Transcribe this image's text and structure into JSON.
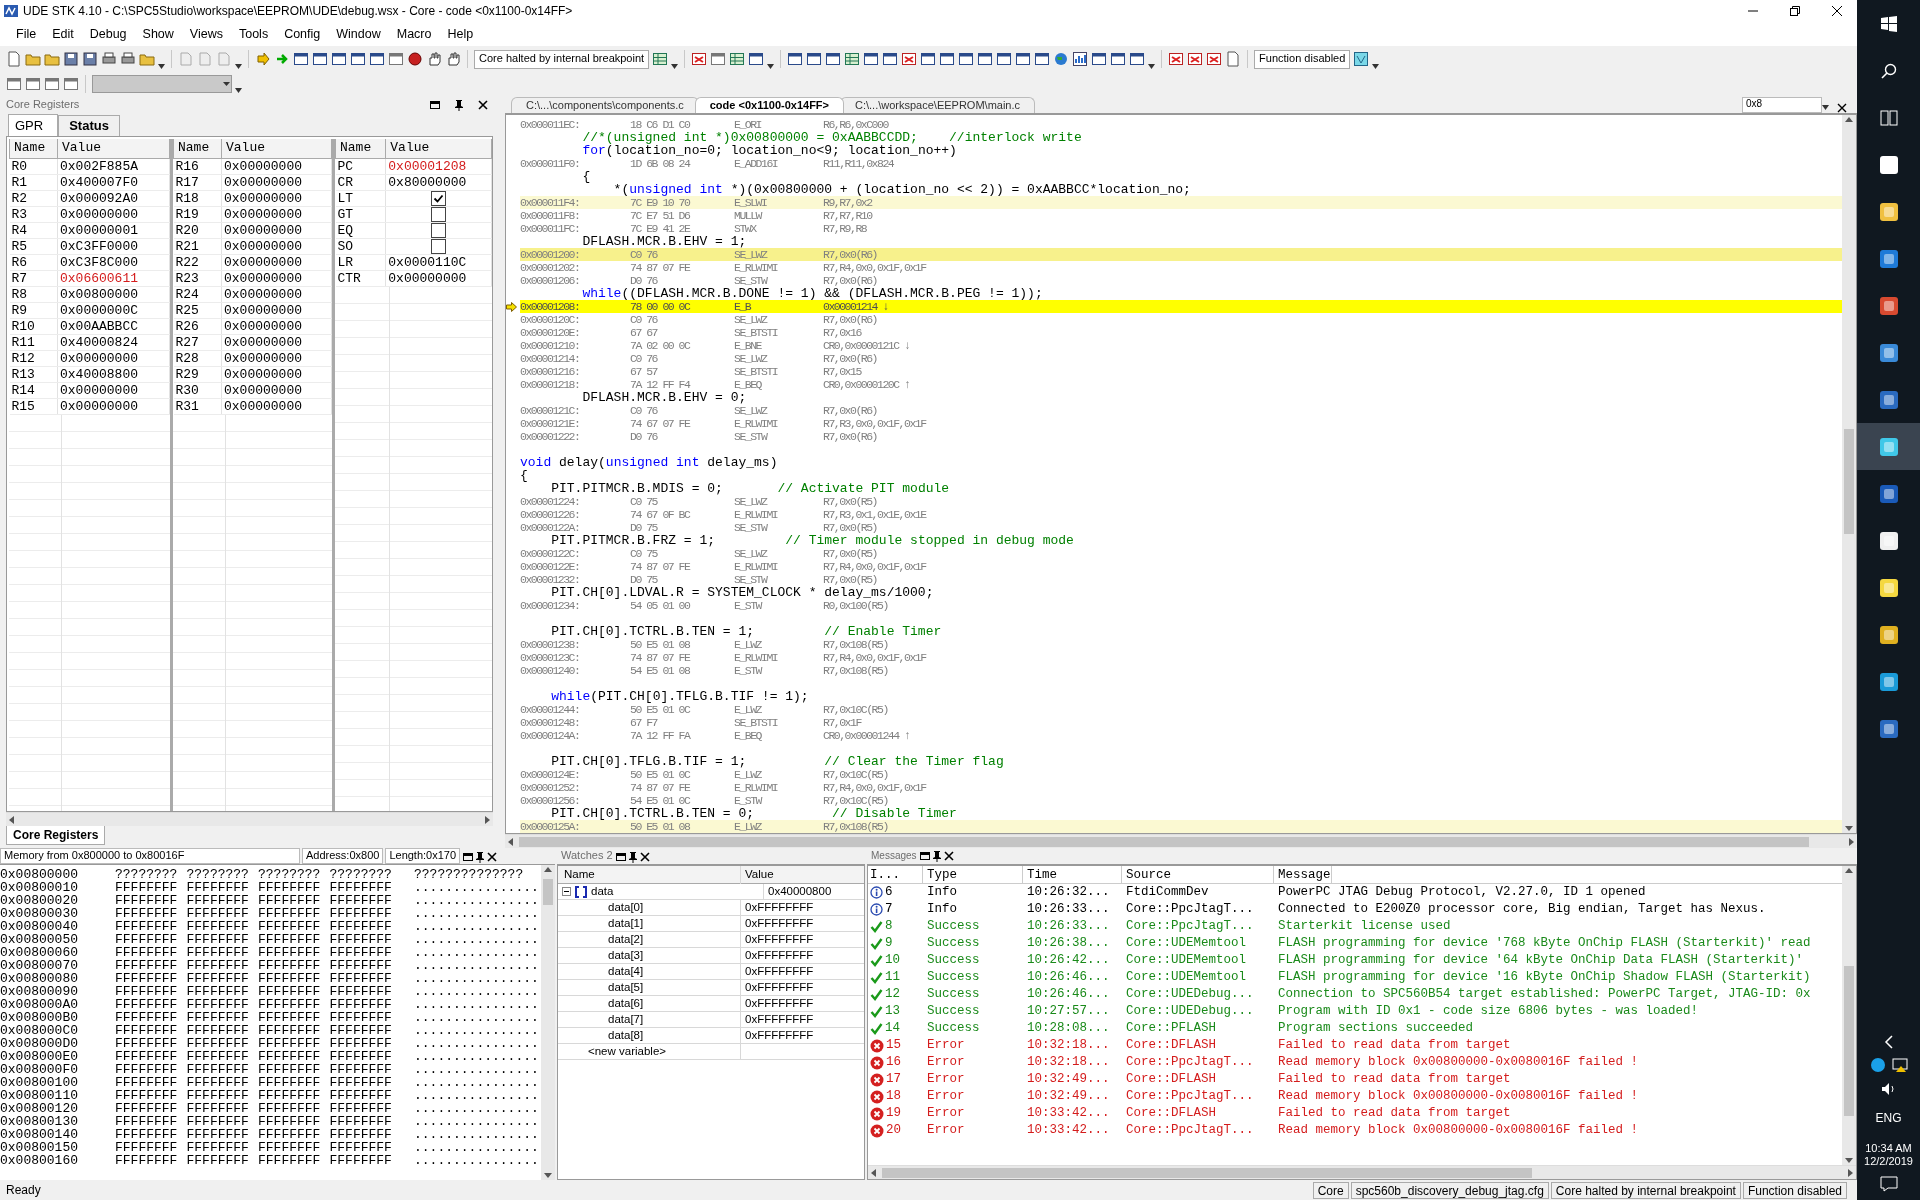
{
  "window": {
    "title": "UDE STK 4.10 - C:\\SPC5Studio\\workspace\\EEPROM\\UDE\\debug.wsx - Core - code <0x1100-0x14FF>"
  },
  "menu": [
    "File",
    "Edit",
    "Debug",
    "Show",
    "Views",
    "Tools",
    "Config",
    "Window",
    "Macro",
    "Help"
  ],
  "toolbar": {
    "status_field": "Core halted by internal breakpoint",
    "function_field": "Function disabled",
    "combo": {
      "disabled": true
    }
  },
  "registers": {
    "title": "Core Registers",
    "tabs": [
      {
        "label": "GPR",
        "selected": true
      },
      {
        "label": "Status",
        "selected": false
      }
    ],
    "groups": [
      {
        "columns": [
          "Name",
          "Value"
        ],
        "rows": [
          {
            "kind": "value",
            "name": "R0",
            "value": "0x002F885A",
            "changed": false
          },
          {
            "kind": "value",
            "name": "R1",
            "value": "0x400007F0",
            "changed": false
          },
          {
            "kind": "value",
            "name": "R2",
            "value": "0x000092A0",
            "changed": false
          },
          {
            "kind": "value",
            "name": "R3",
            "value": "0x00000000",
            "changed": false
          },
          {
            "kind": "value",
            "name": "R4",
            "value": "0x00000001",
            "changed": false
          },
          {
            "kind": "value",
            "name": "R5",
            "value": "0xC3FF0000",
            "changed": false
          },
          {
            "kind": "value",
            "name": "R6",
            "value": "0xC3F8C000",
            "changed": false
          },
          {
            "kind": "value",
            "name": "R7",
            "value": "0x06600611",
            "changed": true
          },
          {
            "kind": "value",
            "name": "R8",
            "value": "0x00800000",
            "changed": false
          },
          {
            "kind": "value",
            "name": "R9",
            "value": "0x0000000C",
            "changed": false
          },
          {
            "kind": "value",
            "name": "R10",
            "value": "0x00AABBCC",
            "changed": false
          },
          {
            "kind": "value",
            "name": "R11",
            "value": "0x40000824",
            "changed": false
          },
          {
            "kind": "value",
            "name": "R12",
            "value": "0x00000000",
            "changed": false
          },
          {
            "kind": "value",
            "name": "R13",
            "value": "0x40008800",
            "changed": false
          },
          {
            "kind": "value",
            "name": "R14",
            "value": "0x00000000",
            "changed": false
          },
          {
            "kind": "value",
            "name": "R15",
            "value": "0x00000000",
            "changed": false
          }
        ]
      },
      {
        "columns": [
          "Name",
          "Value"
        ],
        "rows": [
          {
            "kind": "value",
            "name": "R16",
            "value": "0x00000000",
            "changed": false
          },
          {
            "kind": "value",
            "name": "R17",
            "value": "0x00000000",
            "changed": false
          },
          {
            "kind": "value",
            "name": "R18",
            "value": "0x00000000",
            "changed": false
          },
          {
            "kind": "value",
            "name": "R19",
            "value": "0x00000000",
            "changed": false
          },
          {
            "kind": "value",
            "name": "R20",
            "value": "0x00000000",
            "changed": false
          },
          {
            "kind": "value",
            "name": "R21",
            "value": "0x00000000",
            "changed": false
          },
          {
            "kind": "value",
            "name": "R22",
            "value": "0x00000000",
            "changed": false
          },
          {
            "kind": "value",
            "name": "R23",
            "value": "0x00000000",
            "changed": false
          },
          {
            "kind": "value",
            "name": "R24",
            "value": "0x00000000",
            "changed": false
          },
          {
            "kind": "value",
            "name": "R25",
            "value": "0x00000000",
            "changed": false
          },
          {
            "kind": "value",
            "name": "R26",
            "value": "0x00000000",
            "changed": false
          },
          {
            "kind": "value",
            "name": "R27",
            "value": "0x00000000",
            "changed": false
          },
          {
            "kind": "value",
            "name": "R28",
            "value": "0x00000000",
            "changed": false
          },
          {
            "kind": "value",
            "name": "R29",
            "value": "0x00000000",
            "changed": false
          },
          {
            "kind": "value",
            "name": "R30",
            "value": "0x00000000",
            "changed": false
          },
          {
            "kind": "value",
            "name": "R31",
            "value": "0x00000000",
            "changed": false
          }
        ]
      },
      {
        "columns": [
          "Name",
          "Value"
        ],
        "rows": [
          {
            "kind": "value",
            "name": "PC",
            "value": "0x00001208",
            "changed": true
          },
          {
            "kind": "value",
            "name": "CR",
            "value": "0x80000000",
            "changed": false
          },
          {
            "kind": "flag",
            "name": "LT",
            "checked": true
          },
          {
            "kind": "flag",
            "name": "GT",
            "checked": false
          },
          {
            "kind": "flag",
            "name": "EQ",
            "checked": false
          },
          {
            "kind": "flag",
            "name": "SO",
            "checked": false
          },
          {
            "kind": "value",
            "name": "LR",
            "value": "0x0000110C",
            "changed": false
          },
          {
            "kind": "value",
            "name": "CTR",
            "value": "0x00000000",
            "changed": false
          }
        ]
      }
    ],
    "bottom_tab": {
      "label": "Core Registers",
      "selected": true
    }
  },
  "code": {
    "tabs": [
      {
        "label": "C:\\...\\components\\components.c",
        "selected": false
      },
      {
        "label": "code <0x1100-0x14FF>",
        "selected": true
      },
      {
        "label": "C:\\...\\workspace\\EEPROM\\main.c",
        "selected": false
      }
    ],
    "address_field": "0x8",
    "lines": [
      {
        "kind": "asm",
        "address": "0x000011EC:",
        "bytes": "18 C6 D1 C0",
        "mnemonic": "E_ORI",
        "operands": "R6,R6,0xC000",
        "current": false,
        "highlighted": false,
        "emphasized": false
      },
      {
        "kind": "src",
        "segments": [
          {
            "text": "        //*(unsigned int *)0x00800000 = 0xAABBCCDD;    //interlock write",
            "kind": "comment"
          }
        ]
      },
      {
        "kind": "src",
        "segments": [
          {
            "text": "        for",
            "kind": "keyword"
          },
          {
            "text": "(location_no=0; location_no<9; location_no++)",
            "kind": "plain"
          }
        ]
      },
      {
        "kind": "asm",
        "address": "0x000011F0:",
        "bytes": "1D 6B 08 24",
        "mnemonic": "E_ADD16I",
        "operands": "R11,R11,0x824",
        "current": false,
        "highlighted": false,
        "emphasized": false
      },
      {
        "kind": "src",
        "segments": [
          {
            "text": "        {",
            "kind": "plain"
          }
        ]
      },
      {
        "kind": "src",
        "segments": [
          {
            "text": "            *(",
            "kind": "plain"
          },
          {
            "text": "unsigned int",
            "kind": "keyword"
          },
          {
            "text": " *)(0x00800000 + (location_no << 2)) = 0xAABBCC*location_no;",
            "kind": "plain"
          }
        ]
      },
      {
        "kind": "asm",
        "address": "0x000011F4:",
        "bytes": "7C E9 10 70",
        "mnemonic": "E_SLWI",
        "operands": "R9,R7,0x2",
        "current": false,
        "highlighted": true,
        "emphasized": false
      },
      {
        "kind": "asm",
        "address": "0x000011F8:",
        "bytes": "7C E7 51 D6",
        "mnemonic": "MULLW",
        "operands": "R7,R7,R10",
        "current": false,
        "highlighted": false,
        "emphasized": false
      },
      {
        "kind": "asm",
        "address": "0x000011FC:",
        "bytes": "7C E9 41 2E",
        "mnemonic": "STWX",
        "operands": "R7,R9,R8",
        "current": false,
        "highlighted": false,
        "emphasized": false
      },
      {
        "kind": "src",
        "segments": [
          {
            "text": "        DFLASH.MCR.B.EHV = 1;",
            "kind": "plain"
          }
        ]
      },
      {
        "kind": "asm",
        "address": "0x00001200:",
        "bytes": "C0 76",
        "mnemonic": "SE_LWZ",
        "operands": "R7,0x0(R6)",
        "current": false,
        "highlighted": false,
        "emphasized": true
      },
      {
        "kind": "asm",
        "address": "0x00001202:",
        "bytes": "74 87 07 FE",
        "mnemonic": "E_RLWIMI",
        "operands": "R7,R4,0x0,0x1F,0x1F",
        "current": false,
        "highlighted": false,
        "emphasized": false
      },
      {
        "kind": "asm",
        "address": "0x00001206:",
        "bytes": "D0 76",
        "mnemonic": "SE_STW",
        "operands": "R7,0x0(R6)",
        "current": false,
        "highlighted": false,
        "emphasized": false
      },
      {
        "kind": "src",
        "segments": [
          {
            "text": "        while",
            "kind": "keyword"
          },
          {
            "text": "((DFLASH.MCR.B.DONE != 1) && (DFLASH.MCR.B.PEG != 1));",
            "kind": "plain"
          }
        ]
      },
      {
        "kind": "asm",
        "address": "0x00001208:",
        "bytes": "78 00 00 0C",
        "mnemonic": "E_B",
        "operands": "0x00001214 ↓",
        "current": true,
        "highlighted": false,
        "emphasized": false
      },
      {
        "kind": "asm",
        "address": "0x0000120C:",
        "bytes": "C0 76",
        "mnemonic": "SE_LWZ",
        "operands": "R7,0x0(R6)",
        "current": false,
        "highlighted": false,
        "emphasized": false
      },
      {
        "kind": "asm",
        "address": "0x0000120E:",
        "bytes": "67 67",
        "mnemonic": "SE_BTSTI",
        "operands": "R7,0x16",
        "current": false,
        "highlighted": false,
        "emphasized": false
      },
      {
        "kind": "asm",
        "address": "0x00001210:",
        "bytes": "7A 02 00 0C",
        "mnemonic": "E_BNE",
        "operands": "CR0,0x0000121C ↓",
        "current": false,
        "highlighted": false,
        "emphasized": false
      },
      {
        "kind": "asm",
        "address": "0x00001214:",
        "bytes": "C0 76",
        "mnemonic": "SE_LWZ",
        "operands": "R7,0x0(R6)",
        "current": false,
        "highlighted": false,
        "emphasized": false
      },
      {
        "kind": "asm",
        "address": "0x00001216:",
        "bytes": "67 57",
        "mnemonic": "SE_BTSTI",
        "operands": "R7,0x15",
        "current": false,
        "highlighted": false,
        "emphasized": false
      },
      {
        "kind": "asm",
        "address": "0x00001218:",
        "bytes": "7A 12 FF F4",
        "mnemonic": "E_BEQ",
        "operands": "CR0,0x0000120C ↑",
        "current": false,
        "highlighted": false,
        "emphasized": false
      },
      {
        "kind": "src",
        "segments": [
          {
            "text": "        DFLASH.MCR.B.EHV = 0;",
            "kind": "plain"
          }
        ]
      },
      {
        "kind": "asm",
        "address": "0x0000121C:",
        "bytes": "C0 76",
        "mnemonic": "SE_LWZ",
        "operands": "R7,0x0(R6)",
        "current": false,
        "highlighted": false,
        "emphasized": false
      },
      {
        "kind": "asm",
        "address": "0x0000121E:",
        "bytes": "74 67 07 FE",
        "mnemonic": "E_RLWIMI",
        "operands": "R7,R3,0x0,0x1F,0x1F",
        "current": false,
        "highlighted": false,
        "emphasized": false
      },
      {
        "kind": "asm",
        "address": "0x00001222:",
        "bytes": "D0 76",
        "mnemonic": "SE_STW",
        "operands": "R7,0x0(R6)",
        "current": false,
        "highlighted": false,
        "emphasized": false
      },
      {
        "kind": "blank"
      },
      {
        "kind": "src",
        "segments": [
          {
            "text": "void",
            "kind": "keyword"
          },
          {
            "text": " delay(",
            "kind": "plain"
          },
          {
            "text": "unsigned int",
            "kind": "keyword"
          },
          {
            "text": " delay_ms)",
            "kind": "plain"
          }
        ]
      },
      {
        "kind": "src",
        "segments": [
          {
            "text": "{",
            "kind": "plain"
          }
        ]
      },
      {
        "kind": "src",
        "segments": [
          {
            "text": "    PIT.PITMCR.B.MDIS = 0;",
            "kind": "plain"
          },
          {
            "text": "       // Activate PIT module",
            "kind": "comment"
          }
        ]
      },
      {
        "kind": "asm",
        "address": "0x00001224:",
        "bytes": "C0 75",
        "mnemonic": "SE_LWZ",
        "operands": "R7,0x0(R5)",
        "current": false,
        "highlighted": false,
        "emphasized": false
      },
      {
        "kind": "asm",
        "address": "0x00001226:",
        "bytes": "74 67 0F BC",
        "mnemonic": "E_RLWIMI",
        "operands": "R7,R3,0x1,0x1E,0x1E",
        "current": false,
        "highlighted": false,
        "emphasized": false
      },
      {
        "kind": "asm",
        "address": "0x0000122A:",
        "bytes": "D0 75",
        "mnemonic": "SE_STW",
        "operands": "R7,0x0(R5)",
        "current": false,
        "highlighted": false,
        "emphasized": false
      },
      {
        "kind": "src",
        "segments": [
          {
            "text": "    PIT.PITMCR.B.FRZ = 1;",
            "kind": "plain"
          },
          {
            "text": "         // Timer module stopped in debug mode",
            "kind": "comment"
          }
        ]
      },
      {
        "kind": "asm",
        "address": "0x0000122C:",
        "bytes": "C0 75",
        "mnemonic": "SE_LWZ",
        "operands": "R7,0x0(R5)",
        "current": false,
        "highlighted": false,
        "emphasized": false
      },
      {
        "kind": "asm",
        "address": "0x0000122E:",
        "bytes": "74 87 07 FE",
        "mnemonic": "E_RLWIMI",
        "operands": "R7,R4,0x0,0x1F,0x1F",
        "current": false,
        "highlighted": false,
        "emphasized": false
      },
      {
        "kind": "asm",
        "address": "0x00001232:",
        "bytes": "D0 75",
        "mnemonic": "SE_STW",
        "operands": "R7,0x0(R5)",
        "current": false,
        "highlighted": false,
        "emphasized": false
      },
      {
        "kind": "src",
        "segments": [
          {
            "text": "    PIT.CH[0].LDVAL.R = SYSTEM_CLOCK * delay_ms/1000;",
            "kind": "plain"
          }
        ]
      },
      {
        "kind": "asm",
        "address": "0x00001234:",
        "bytes": "54 05 01 00",
        "mnemonic": "E_STW",
        "operands": "R0,0x100(R5)",
        "current": false,
        "highlighted": false,
        "emphasized": false
      },
      {
        "kind": "blank"
      },
      {
        "kind": "src",
        "segments": [
          {
            "text": "    PIT.CH[0].TCTRL.B.TEN = 1;",
            "kind": "plain"
          },
          {
            "text": "         // Enable Timer",
            "kind": "comment"
          }
        ]
      },
      {
        "kind": "asm",
        "address": "0x00001238:",
        "bytes": "50 E5 01 08",
        "mnemonic": "E_LWZ",
        "operands": "R7,0x108(R5)",
        "current": false,
        "highlighted": false,
        "emphasized": false
      },
      {
        "kind": "asm",
        "address": "0x0000123C:",
        "bytes": "74 87 07 FE",
        "mnemonic": "E_RLWIMI",
        "operands": "R7,R4,0x0,0x1F,0x1F",
        "current": false,
        "highlighted": false,
        "emphasized": false
      },
      {
        "kind": "asm",
        "address": "0x00001240:",
        "bytes": "54 E5 01 08",
        "mnemonic": "E_STW",
        "operands": "R7,0x108(R5)",
        "current": false,
        "highlighted": false,
        "emphasized": false
      },
      {
        "kind": "blank"
      },
      {
        "kind": "src",
        "segments": [
          {
            "text": "    while",
            "kind": "keyword"
          },
          {
            "text": "(PIT.CH[0].TFLG.B.TIF != 1);",
            "kind": "plain"
          }
        ]
      },
      {
        "kind": "asm",
        "address": "0x00001244:",
        "bytes": "50 E5 01 0C",
        "mnemonic": "E_LWZ",
        "operands": "R7,0x10C(R5)",
        "current": false,
        "highlighted": false,
        "emphasized": false
      },
      {
        "kind": "asm",
        "address": "0x00001248:",
        "bytes": "67 F7",
        "mnemonic": "SE_BTSTI",
        "operands": "R7,0x1F",
        "current": false,
        "highlighted": false,
        "emphasized": false
      },
      {
        "kind": "asm",
        "address": "0x0000124A:",
        "bytes": "7A 12 FF FA",
        "mnemonic": "E_BEQ",
        "operands": "CR0,0x00001244 ↑",
        "current": false,
        "highlighted": false,
        "emphasized": false
      },
      {
        "kind": "blank"
      },
      {
        "kind": "src",
        "segments": [
          {
            "text": "    PIT.CH[0].TFLG.B.TIF = 1;",
            "kind": "plain"
          },
          {
            "text": "          // Clear the Timer flag",
            "kind": "comment"
          }
        ]
      },
      {
        "kind": "asm",
        "address": "0x0000124E:",
        "bytes": "50 E5 01 0C",
        "mnemonic": "E_LWZ",
        "operands": "R7,0x10C(R5)",
        "current": false,
        "highlighted": false,
        "emphasized": false
      },
      {
        "kind": "asm",
        "address": "0x00001252:",
        "bytes": "74 87 07 FE",
        "mnemonic": "E_RLWIMI",
        "operands": "R7,R4,0x0,0x1F,0x1F",
        "current": false,
        "highlighted": false,
        "emphasized": false
      },
      {
        "kind": "asm",
        "address": "0x00001256:",
        "bytes": "54 E5 01 0C",
        "mnemonic": "E_STW",
        "operands": "R7,0x10C(R5)",
        "current": false,
        "highlighted": false,
        "emphasized": false
      },
      {
        "kind": "src",
        "segments": [
          {
            "text": "    PIT.CH[0].TCTRL.B.TEN = 0;",
            "kind": "plain"
          },
          {
            "text": "          // Disable Timer",
            "kind": "comment"
          }
        ]
      },
      {
        "kind": "asm",
        "address": "0x0000125A:",
        "bytes": "50 E5 01 08",
        "mnemonic": "E_LWZ",
        "operands": "R7,0x108(R5)",
        "current": false,
        "highlighted": true,
        "emphasized": false
      }
    ]
  },
  "memory": {
    "title": "Memory from 0x800000 to 0x80016F",
    "address_field": "Address:0x800",
    "length_field": "Length:0x170",
    "rows": [
      {
        "address": "0x00800000",
        "words": [
          "????????",
          "????????",
          "????????",
          "????????"
        ],
        "ascii": "??????????????"
      },
      {
        "address": "0x00800010",
        "words": [
          "FFFFFFFF",
          "FFFFFFFF",
          "FFFFFFFF",
          "FFFFFFFF"
        ],
        "ascii": "................"
      },
      {
        "address": "0x00800020",
        "words": [
          "FFFFFFFF",
          "FFFFFFFF",
          "FFFFFFFF",
          "FFFFFFFF"
        ],
        "ascii": "................"
      },
      {
        "address": "0x00800030",
        "words": [
          "FFFFFFFF",
          "FFFFFFFF",
          "FFFFFFFF",
          "FFFFFFFF"
        ],
        "ascii": "................"
      },
      {
        "address": "0x00800040",
        "words": [
          "FFFFFFFF",
          "FFFFFFFF",
          "FFFFFFFF",
          "FFFFFFFF"
        ],
        "ascii": "................"
      },
      {
        "address": "0x00800050",
        "words": [
          "FFFFFFFF",
          "FFFFFFFF",
          "FFFFFFFF",
          "FFFFFFFF"
        ],
        "ascii": "................"
      },
      {
        "address": "0x00800060",
        "words": [
          "FFFFFFFF",
          "FFFFFFFF",
          "FFFFFFFF",
          "FFFFFFFF"
        ],
        "ascii": "................"
      },
      {
        "address": "0x00800070",
        "words": [
          "FFFFFFFF",
          "FFFFFFFF",
          "FFFFFFFF",
          "FFFFFFFF"
        ],
        "ascii": "................"
      },
      {
        "address": "0x00800080",
        "words": [
          "FFFFFFFF",
          "FFFFFFFF",
          "FFFFFFFF",
          "FFFFFFFF"
        ],
        "ascii": "................"
      },
      {
        "address": "0x00800090",
        "words": [
          "FFFFFFFF",
          "FFFFFFFF",
          "FFFFFFFF",
          "FFFFFFFF"
        ],
        "ascii": "................"
      },
      {
        "address": "0x008000A0",
        "words": [
          "FFFFFFFF",
          "FFFFFFFF",
          "FFFFFFFF",
          "FFFFFFFF"
        ],
        "ascii": "................"
      },
      {
        "address": "0x008000B0",
        "words": [
          "FFFFFFFF",
          "FFFFFFFF",
          "FFFFFFFF",
          "FFFFFFFF"
        ],
        "ascii": "................"
      },
      {
        "address": "0x008000C0",
        "words": [
          "FFFFFFFF",
          "FFFFFFFF",
          "FFFFFFFF",
          "FFFFFFFF"
        ],
        "ascii": "................"
      },
      {
        "address": "0x008000D0",
        "words": [
          "FFFFFFFF",
          "FFFFFFFF",
          "FFFFFFFF",
          "FFFFFFFF"
        ],
        "ascii": "................"
      },
      {
        "address": "0x008000E0",
        "words": [
          "FFFFFFFF",
          "FFFFFFFF",
          "FFFFFFFF",
          "FFFFFFFF"
        ],
        "ascii": "................"
      },
      {
        "address": "0x008000F0",
        "words": [
          "FFFFFFFF",
          "FFFFFFFF",
          "FFFFFFFF",
          "FFFFFFFF"
        ],
        "ascii": "................"
      },
      {
        "address": "0x00800100",
        "words": [
          "FFFFFFFF",
          "FFFFFFFF",
          "FFFFFFFF",
          "FFFFFFFF"
        ],
        "ascii": "................"
      },
      {
        "address": "0x00800110",
        "words": [
          "FFFFFFFF",
          "FFFFFFFF",
          "FFFFFFFF",
          "FFFFFFFF"
        ],
        "ascii": "................"
      },
      {
        "address": "0x00800120",
        "words": [
          "FFFFFFFF",
          "FFFFFFFF",
          "FFFFFFFF",
          "FFFFFFFF"
        ],
        "ascii": "................"
      },
      {
        "address": "0x00800130",
        "words": [
          "FFFFFFFF",
          "FFFFFFFF",
          "FFFFFFFF",
          "FFFFFFFF"
        ],
        "ascii": "................"
      },
      {
        "address": "0x00800140",
        "words": [
          "FFFFFFFF",
          "FFFFFFFF",
          "FFFFFFFF",
          "FFFFFFFF"
        ],
        "ascii": "................"
      },
      {
        "address": "0x00800150",
        "words": [
          "FFFFFFFF",
          "FFFFFFFF",
          "FFFFFFFF",
          "FFFFFFFF"
        ],
        "ascii": "................"
      },
      {
        "address": "0x00800160",
        "words": [
          "FFFFFFFF",
          "FFFFFFFF",
          "FFFFFFFF",
          "FFFFFFFF"
        ],
        "ascii": "................"
      }
    ]
  },
  "watches": {
    "title": "Watches 2",
    "columns": [
      "Name",
      "Value"
    ],
    "rows": [
      {
        "name": "data",
        "value": "0x40000800",
        "expanded": true,
        "children": [
          {
            "name": "data[0]",
            "value": "0xFFFFFFFF"
          },
          {
            "name": "data[1]",
            "value": "0xFFFFFFFF"
          },
          {
            "name": "data[2]",
            "value": "0xFFFFFFFF"
          },
          {
            "name": "data[3]",
            "value": "0xFFFFFFFF"
          },
          {
            "name": "data[4]",
            "value": "0xFFFFFFFF"
          },
          {
            "name": "data[5]",
            "value": "0xFFFFFFFF"
          },
          {
            "name": "data[6]",
            "value": "0xFFFFFFFF"
          },
          {
            "name": "data[7]",
            "value": "0xFFFFFFFF"
          },
          {
            "name": "data[8]",
            "value": "0xFFFFFFFF"
          }
        ]
      }
    ],
    "new_row": "<new variable>"
  },
  "messages": {
    "title": "Messages",
    "columns": [
      "I...",
      "Type",
      "Time",
      "Source",
      "Message"
    ],
    "rows": [
      {
        "kind": "info",
        "id": "6",
        "type": "Info",
        "time": "10:26:32...",
        "source": "FtdiCommDev",
        "text": "PowerPC JTAG Debug Protocol, V2.27.0, ID 1 opened"
      },
      {
        "kind": "info",
        "id": "7",
        "type": "Info",
        "time": "10:26:33...",
        "source": "Core::PpcJtagT...",
        "text": "Connected to E200Z0 processor core, Big endian, Target has Nexus."
      },
      {
        "kind": "success",
        "id": "8",
        "type": "Success",
        "time": "10:26:33...",
        "source": "Core::PpcJtagT...",
        "text": "Starterkit license used"
      },
      {
        "kind": "success",
        "id": "9",
        "type": "Success",
        "time": "10:26:38...",
        "source": "Core::UDEMemtool",
        "text": "FLASH programming for device '768 kByte OnChip FLASH (Starterkit)' read"
      },
      {
        "kind": "success",
        "id": "10",
        "type": "Success",
        "time": "10:26:42...",
        "source": "Core::UDEMemtool",
        "text": "FLASH programming for device '64 kByte OnChip Data FLASH (Starterkit)'"
      },
      {
        "kind": "success",
        "id": "11",
        "type": "Success",
        "time": "10:26:46...",
        "source": "Core::UDEMemtool",
        "text": "FLASH programming for device '16 kByte OnChip Shadow FLASH (Starterkit)"
      },
      {
        "kind": "success",
        "id": "12",
        "type": "Success",
        "time": "10:26:46...",
        "source": "Core::UDEDebug...",
        "text": "Connection to SPC560B54 target established: PowerPC Target, JTAG-ID: 0x"
      },
      {
        "kind": "success",
        "id": "13",
        "type": "Success",
        "time": "10:27:57...",
        "source": "Core::UDEDebug...",
        "text": "Program with ID 0x1 - code size 6806 bytes - was loaded!"
      },
      {
        "kind": "success",
        "id": "14",
        "type": "Success",
        "time": "10:28:08...",
        "source": "Core::PFLASH",
        "text": "Program sections succeeded"
      },
      {
        "kind": "error",
        "id": "15",
        "type": "Error",
        "time": "10:32:18...",
        "source": "Core::DFLASH",
        "text": "Failed to read data from target"
      },
      {
        "kind": "error",
        "id": "16",
        "type": "Error",
        "time": "10:32:18...",
        "source": "Core::PpcJtagT...",
        "text": "Read memory block 0x00800000-0x0080016F failed !"
      },
      {
        "kind": "error",
        "id": "17",
        "type": "Error",
        "time": "10:32:49...",
        "source": "Core::DFLASH",
        "text": "Failed to read data from target"
      },
      {
        "kind": "error",
        "id": "18",
        "type": "Error",
        "time": "10:32:49...",
        "source": "Core::PpcJtagT...",
        "text": "Read memory block 0x00800000-0x0080016F failed !"
      },
      {
        "kind": "error",
        "id": "19",
        "type": "Error",
        "time": "10:33:42...",
        "source": "Core::DFLASH",
        "text": "Failed to read data from target"
      },
      {
        "kind": "error",
        "id": "20",
        "type": "Error",
        "time": "10:33:42...",
        "source": "Core::PpcJtagT...",
        "text": "Read memory block 0x00800000-0x0080016F failed !"
      }
    ]
  },
  "status_bar": {
    "text": "Ready",
    "panes": [
      "Core",
      "spc560b_discovery_debug_jtag.cfg",
      "Core halted by internal breakpoint",
      "Function disabled"
    ]
  },
  "taskbar": {
    "language": "ENG",
    "time": "10:34 AM",
    "date": "12/2/2019"
  }
}
